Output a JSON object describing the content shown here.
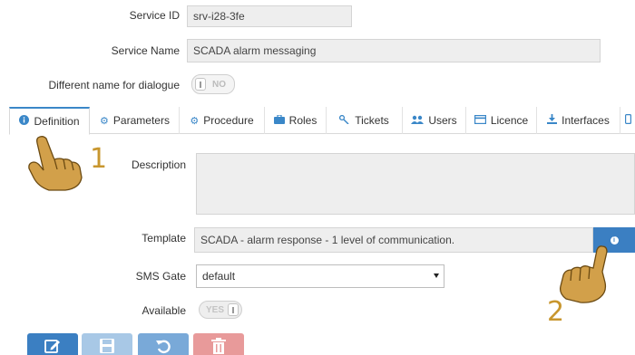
{
  "form": {
    "service_id_label": "Service ID",
    "service_id_value": "srv-i28-3fe",
    "service_name_label": "Service Name",
    "service_name_value": "SCADA alarm messaging",
    "diff_name_label": "Different name for dialogue",
    "diff_name_toggle": "NO"
  },
  "tabs": [
    {
      "label": "Definition",
      "icon": "info-icon"
    },
    {
      "label": "Parameters",
      "icon": "gear-icon"
    },
    {
      "label": "Procedure",
      "icon": "cogs-icon"
    },
    {
      "label": "Roles",
      "icon": "briefcase-icon"
    },
    {
      "label": "Tickets",
      "icon": "key-icon"
    },
    {
      "label": "Users",
      "icon": "users-icon"
    },
    {
      "label": "Licence",
      "icon": "card-icon"
    },
    {
      "label": "Interfaces",
      "icon": "download-icon"
    }
  ],
  "definition": {
    "description_label": "Description",
    "description_value": "",
    "template_label": "Template",
    "template_value": "SCADA - alarm response - 1 level of communication.",
    "sms_gate_label": "SMS Gate",
    "sms_gate_value": "default",
    "available_label": "Available",
    "available_toggle": "YES"
  },
  "annotations": {
    "step_1": "1",
    "step_2": "2"
  },
  "colors": {
    "accent_blue": "#3b7fc2",
    "save_button": "#a8c8e6",
    "reset_button": "#79a9d8",
    "delete_button": "#e89a9a",
    "annotation_gold": "#c8962e"
  }
}
